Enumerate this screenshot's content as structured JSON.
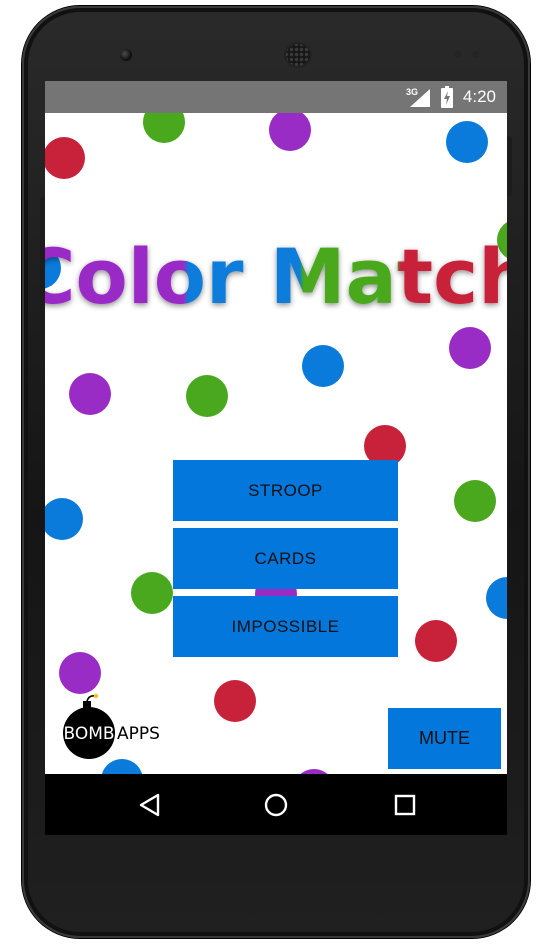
{
  "status_bar": {
    "network": "3G",
    "time": "4:20"
  },
  "title": {
    "text": "Color Match",
    "colors": {
      "purple": "#9a2cc6",
      "blue": "#0a7bdb",
      "green": "#4aa81e",
      "red": "#c8223b"
    }
  },
  "menu": {
    "stroop": "STROOP",
    "cards": "CARDS",
    "impossible": "IMPOSSIBLE"
  },
  "mute_label": "MUTE",
  "brand": {
    "bomb": "BOMB",
    "apps": "APPS"
  },
  "navigation": {
    "back_icon": "back-triangle-icon",
    "home_icon": "home-circle-icon",
    "recent_icon": "recent-square-icon"
  },
  "palette": {
    "button": "#0477dc",
    "status_bar": "#757575",
    "nav_bar": "#000000"
  }
}
